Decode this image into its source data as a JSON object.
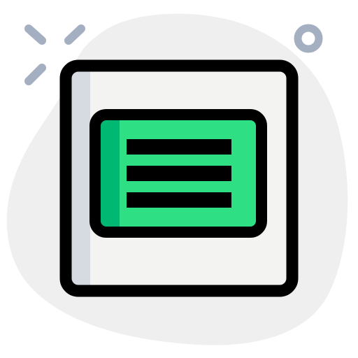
{
  "icon": {
    "name": "article-card-icon",
    "style": "flat-outline-with-blob-background"
  },
  "colors": {
    "page_background": "#ffffff",
    "blob": "#efefef",
    "sparkle": "#a4afc1",
    "outline": "#000000",
    "document_fill": "#f3f3f1",
    "document_side_strip": "#d5dbe1",
    "card_fill": "#2fdf84",
    "card_side_strip": "#00b871",
    "text_lines": "#000000"
  },
  "card": {
    "text_line_count": 3
  }
}
